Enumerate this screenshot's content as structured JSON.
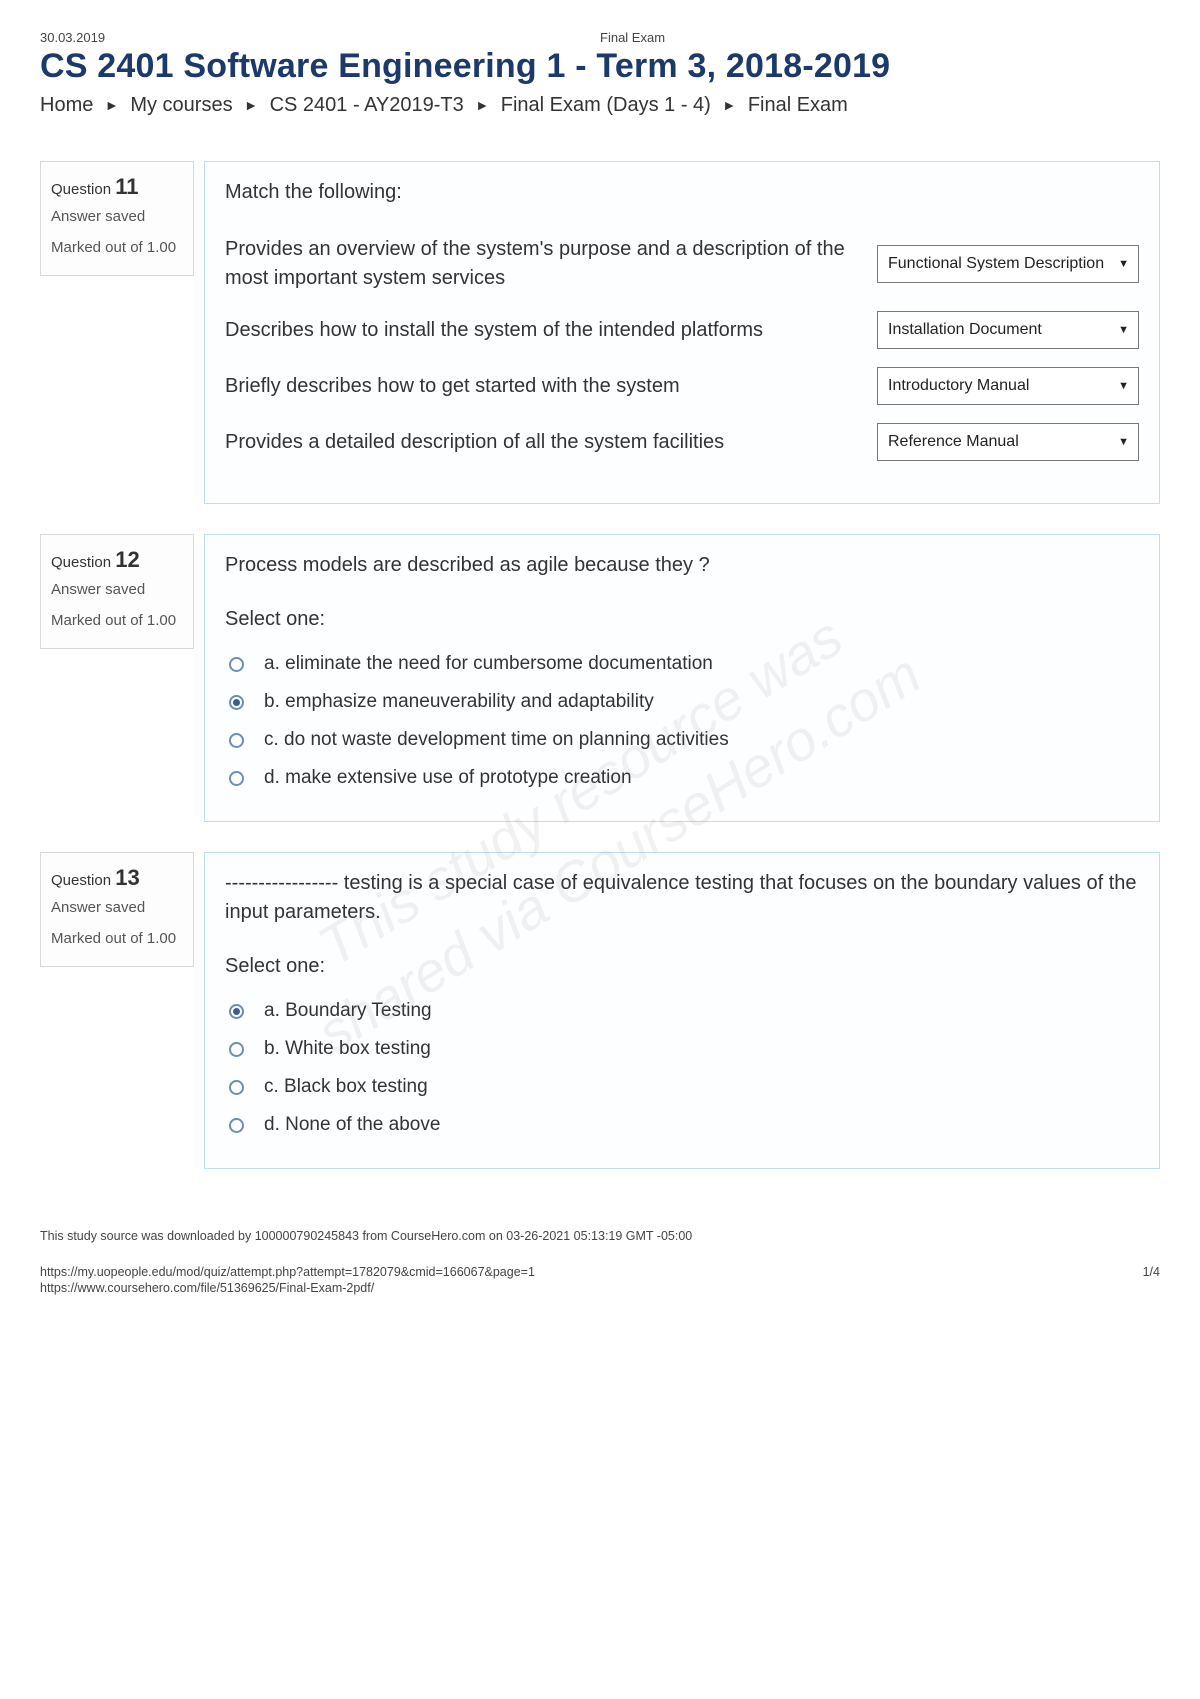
{
  "meta": {
    "date": "30.03.2019",
    "header_small": "Final Exam",
    "page_title": "CS 2401 Software Engineering 1 - Term 3, 2018-2019"
  },
  "breadcrumb": {
    "items": [
      "Home",
      "My courses",
      "CS 2401 - AY2019-T3",
      "Final Exam (Days 1 - 4)",
      "Final Exam"
    ]
  },
  "questions": [
    {
      "number_label": "Question",
      "number": "11",
      "status": "Answer saved",
      "marks": "Marked out of 1.00",
      "type": "match",
      "prompt": "Match the following:",
      "matches": [
        {
          "text": "Provides an overview of the system's purpose and a description of the most important system services",
          "answer": "Functional System Description"
        },
        {
          "text": "Describes how to install the system of the intended platforms",
          "answer": "Installation Document"
        },
        {
          "text": "Briefly describes how to get started with the system",
          "answer": "Introductory Manual"
        },
        {
          "text": "Provides a detailed description of all the system facilities",
          "answer": "Reference Manual"
        }
      ]
    },
    {
      "number_label": "Question",
      "number": "12",
      "status": "Answer saved",
      "marks": "Marked out of 1.00",
      "type": "mc",
      "prompt": "Process models are described as agile because they ?",
      "select_one": "Select one:",
      "options": [
        {
          "label": "a. eliminate the need for cumbersome documentation",
          "checked": false
        },
        {
          "label": "b. emphasize maneuverability and adaptability",
          "checked": true
        },
        {
          "label": "c. do not waste development time on planning activities",
          "checked": false
        },
        {
          "label": "d. make extensive use of prototype creation",
          "checked": false
        }
      ]
    },
    {
      "number_label": "Question",
      "number": "13",
      "status": "Answer saved",
      "marks": "Marked out of 1.00",
      "type": "mc",
      "prompt": "----------------- testing is a special case of equivalence testing that focuses on the boundary values of the input parameters.",
      "select_one": "Select one:",
      "options": [
        {
          "label": "a. Boundary Testing",
          "checked": true
        },
        {
          "label": "b. White box testing",
          "checked": false
        },
        {
          "label": "c. Black box testing",
          "checked": false
        },
        {
          "label": "d. None of the above",
          "checked": false
        }
      ]
    }
  ],
  "watermark": {
    "line1": "This study resource was",
    "line2": "shared via CourseHero.com"
  },
  "footnote": "This study source was downloaded by 100000790245843 from CourseHero.com on 03-26-2021 05:13:19 GMT -05:00",
  "footer": {
    "url1": "https://my.uopeople.edu/mod/quiz/attempt.php?attempt=1782079&cmid=166067&page=1",
    "url2": "https://www.coursehero.com/file/51369625/Final-Exam-2pdf/",
    "page_count": "1/4"
  }
}
